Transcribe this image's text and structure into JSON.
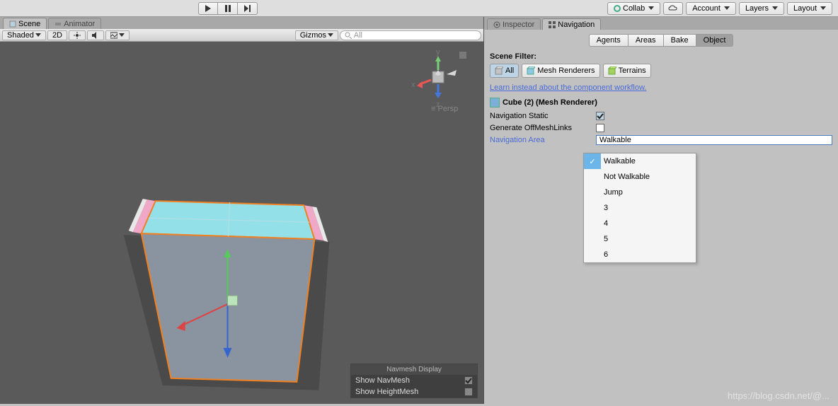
{
  "top": {
    "collab": "Collab",
    "account": "Account",
    "layers": "Layers",
    "layout": "Layout"
  },
  "leftTabs": {
    "scene": "Scene",
    "animator": "Animator"
  },
  "rightTabs": {
    "inspector": "Inspector",
    "navigation": "Navigation"
  },
  "sceneToolbar": {
    "shaded": "Shaded",
    "mode2d": "2D",
    "gizmos": "Gizmos",
    "searchPlaceholder": "All"
  },
  "navTabs": {
    "agents": "Agents",
    "areas": "Areas",
    "bake": "Bake",
    "object": "Object"
  },
  "nav": {
    "sceneFilter": "Scene Filter:",
    "all": "All",
    "meshRenderers": "Mesh Renderers",
    "terrains": "Terrains",
    "learnLink": "Learn instead about the component workflow.",
    "objectTitle": "Cube (2) (Mesh Renderer)",
    "navStatic": "Navigation Static",
    "genOffMesh": "Generate OffMeshLinks",
    "navArea": "Navigation Area",
    "navAreaValue": "Walkable"
  },
  "dropdown": {
    "items": [
      "Walkable",
      "Not Walkable",
      "Jump",
      "3",
      "4",
      "5",
      "6"
    ],
    "selected": "Walkable"
  },
  "navmeshDisplay": {
    "title": "Navmesh Display",
    "showNavMesh": "Show NavMesh",
    "showHeightMesh": "Show HeightMesh"
  },
  "viewportGizmo": {
    "persp": "Persp",
    "x": "x",
    "y": "y",
    "z": "z"
  },
  "watermark": "https://blog.csdn.net/@..."
}
